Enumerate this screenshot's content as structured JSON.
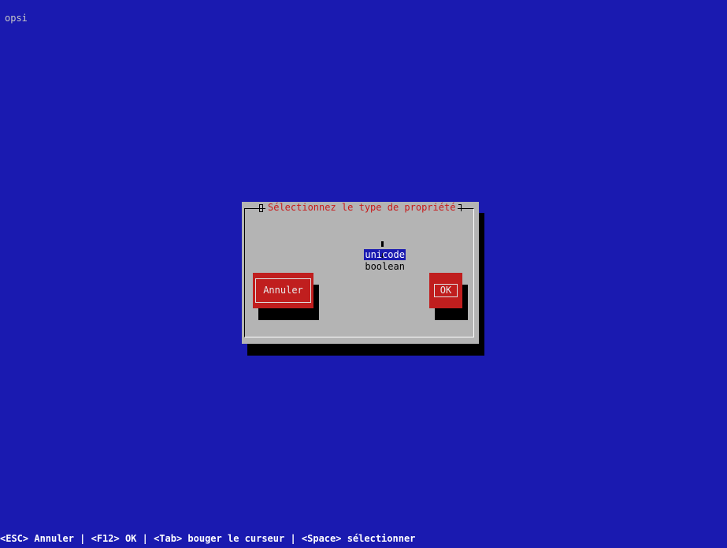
{
  "app": {
    "title": "opsi"
  },
  "dialog": {
    "title": "Sélectionnez le type de propriété",
    "options": [
      {
        "label": "unicode",
        "selected": true
      },
      {
        "label": "boolean",
        "selected": false
      }
    ],
    "scroll_indicator": "↓",
    "buttons": {
      "cancel": "Annuler",
      "ok": "OK"
    }
  },
  "footer": {
    "hint": "<ESC> Annuler | <F12> OK | <Tab> bouger le curseur | <Space> sélectionner"
  },
  "colors": {
    "background": "#1a1ab0",
    "dialog": "#b4b4b4",
    "button": "#c01e1e",
    "title": "#c81a1a"
  }
}
